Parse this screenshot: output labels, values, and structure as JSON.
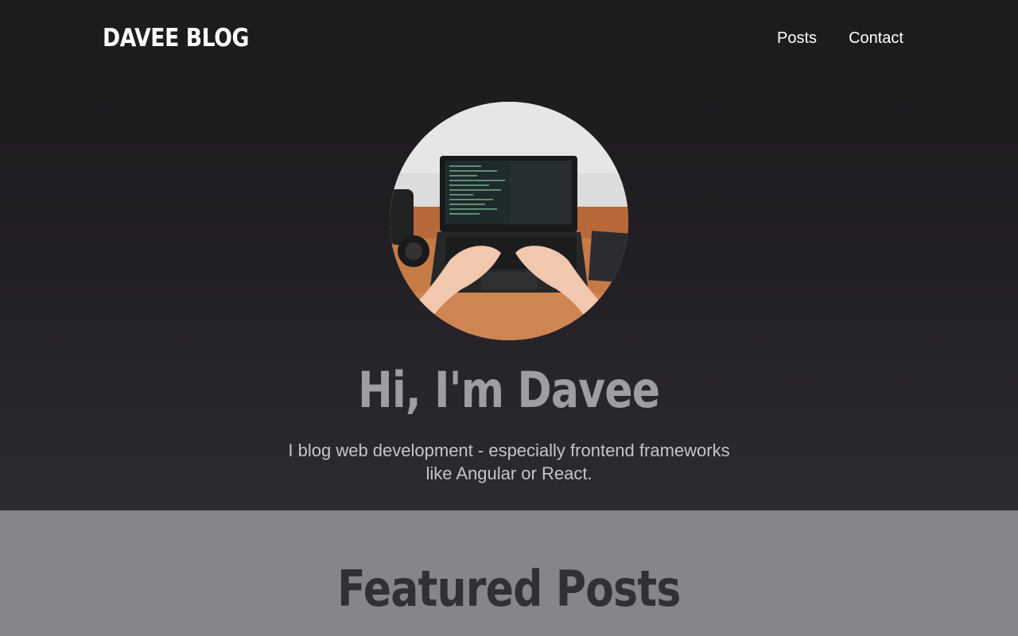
{
  "header": {
    "logo": "DAVEE BLOG",
    "nav": [
      {
        "label": "Posts"
      },
      {
        "label": "Contact"
      }
    ]
  },
  "hero": {
    "title": "Hi, I'm Davee",
    "subtitle_line1": "I blog web development - especially frontend frameworks",
    "subtitle_line2": "like Angular or React."
  },
  "featured": {
    "title": "Featured Posts"
  },
  "colors": {
    "hero_bg_top": "#1c191c",
    "hero_bg_bottom": "#2d2a31",
    "featured_bg": "#87858c",
    "title_gray": "#9f9ca3"
  }
}
